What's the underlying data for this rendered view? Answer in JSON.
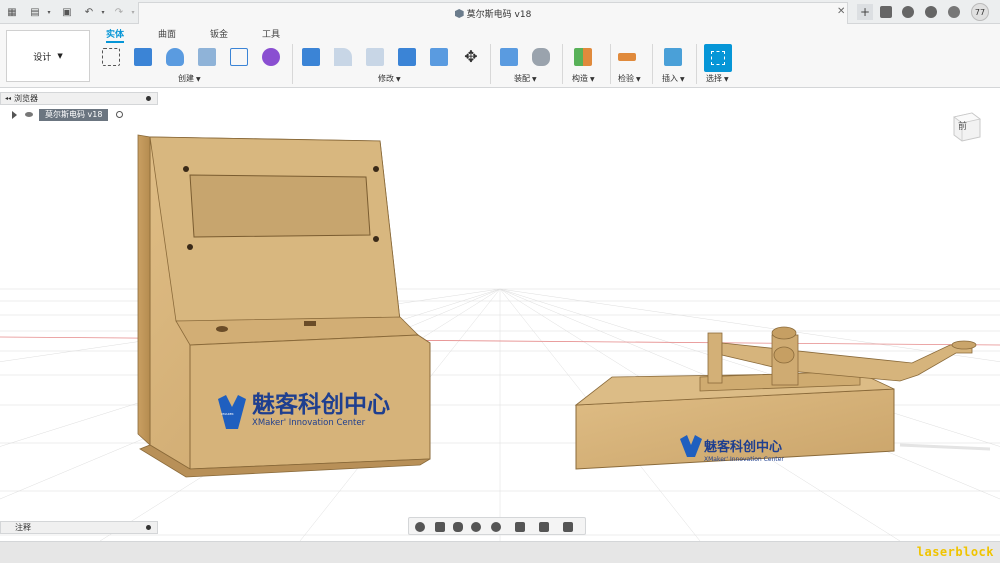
{
  "titlebar": {
    "document_title": "莫尔斯电码 v18",
    "user_badge": "77"
  },
  "ribbon": {
    "workspace": "设计",
    "tabs": [
      "实体",
      "曲面",
      "钣金",
      "工具"
    ],
    "groups": {
      "create": "创建",
      "modify": "修改",
      "assemble": "装配",
      "construct": "构造",
      "inspect": "检验",
      "insert": "插入",
      "select": "选择"
    }
  },
  "browser": {
    "title": "浏览器",
    "root_item": "莫尔斯电码 v18"
  },
  "comments": {
    "title": "注释"
  },
  "viewcube": {
    "face": "前"
  },
  "model": {
    "logo_text": "魅客科创中心",
    "logo_sub": "XMaker' Innovation Center",
    "logo_mark": "XMAKER"
  },
  "watermark": "laserblock",
  "colors": {
    "accent": "#0696d7",
    "wood": "#d9b57a",
    "wood_dark": "#b8904f",
    "logo_blue": "#1f5fbf"
  }
}
